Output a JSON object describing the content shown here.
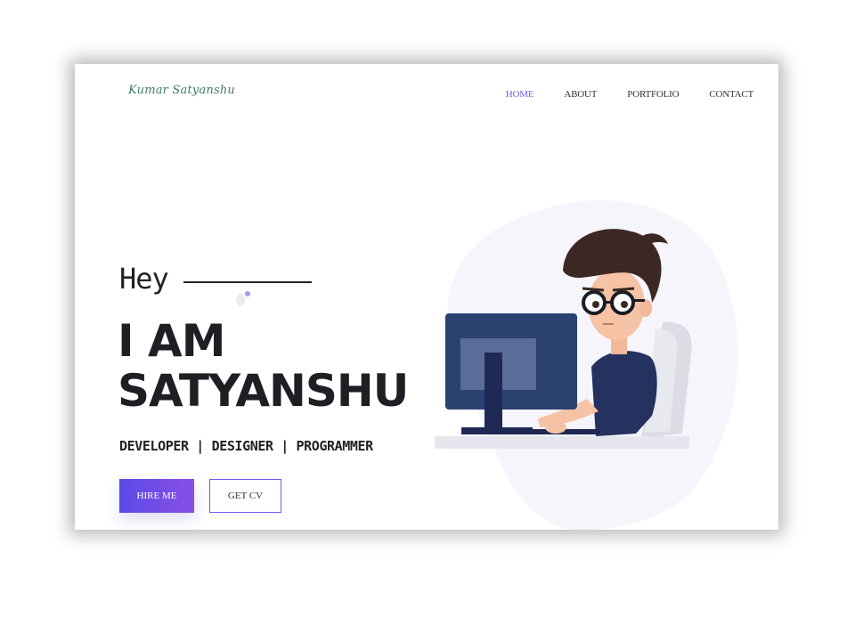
{
  "logo": {
    "text": "Kumar Satyanshu"
  },
  "nav": {
    "items": [
      {
        "label": "HOME",
        "active": true
      },
      {
        "label": "ABOUT",
        "active": false
      },
      {
        "label": "PORTFOLIO",
        "active": false
      },
      {
        "label": "CONTACT",
        "active": false
      }
    ]
  },
  "hero": {
    "greeting": "Hey",
    "title_line1": "I AM",
    "title_line2": "SATYANSHU",
    "roles": "DEVELOPER | DESIGNER | PROGRAMMER",
    "hire_button": "HIRE ME",
    "cv_button": "GET CV"
  },
  "colors": {
    "accent": "#6e5cf0",
    "button_gradient_start": "#5b4be6",
    "button_gradient_end": "#8a4ee8",
    "text_dark": "#1e1e24",
    "logo": "#3f7a6a"
  },
  "icons": {
    "illustration": "developer-at-computer-illustration"
  }
}
